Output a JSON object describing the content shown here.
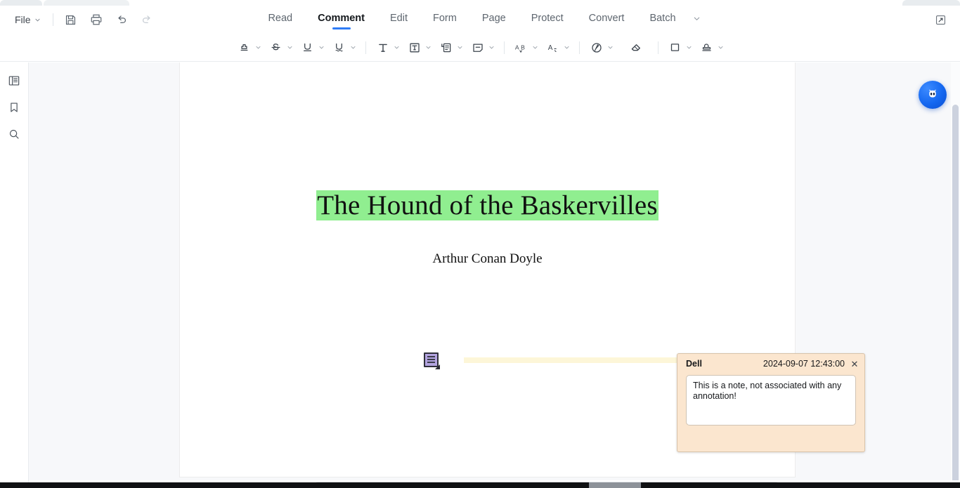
{
  "app": {
    "file_menu": "File",
    "quick_actions": [
      {
        "name": "save-button",
        "label": "Save",
        "enabled": true
      },
      {
        "name": "print-button",
        "label": "Print",
        "enabled": true
      },
      {
        "name": "undo-button",
        "label": "Undo",
        "enabled": true
      },
      {
        "name": "redo-button",
        "label": "Redo",
        "enabled": false
      }
    ],
    "expand_icon": "external-link-icon"
  },
  "ribbon": {
    "tabs": [
      {
        "label": "Read",
        "active": false
      },
      {
        "label": "Comment",
        "active": true
      },
      {
        "label": "Edit",
        "active": false
      },
      {
        "label": "Form",
        "active": false
      },
      {
        "label": "Page",
        "active": false
      },
      {
        "label": "Protect",
        "active": false
      },
      {
        "label": "Convert",
        "active": false
      },
      {
        "label": "Batch",
        "active": false
      }
    ],
    "more_icon": "chevron-down-icon",
    "active_underline_color": "#2f7cf6"
  },
  "toolbar": {
    "tools": [
      {
        "name": "highlight-tool",
        "icon": "highlighter-icon",
        "label": "Highlight",
        "caret": true
      },
      {
        "name": "strikethrough-tool",
        "icon": "strikethrough-icon",
        "label": "Strikethrough",
        "caret": true
      },
      {
        "name": "underline-tool",
        "icon": "underline-icon",
        "label": "Underline",
        "caret": true
      },
      {
        "name": "squiggly-underline-tool",
        "icon": "squiggly-underline-icon",
        "label": "Squiggly Underline",
        "caret": true
      },
      {
        "name": "separator-1",
        "icon": "separator",
        "label": "",
        "caret": false
      },
      {
        "name": "text-tool",
        "icon": "text-icon",
        "label": "Typewriter",
        "caret": true
      },
      {
        "name": "text-box-tool",
        "icon": "text-box-icon",
        "label": "Text Box",
        "caret": true
      },
      {
        "name": "callout-tool",
        "icon": "callout-icon",
        "label": "Callout",
        "caret": true
      },
      {
        "name": "note-tool",
        "icon": "sticky-note-icon",
        "label": "Note",
        "caret": true
      },
      {
        "name": "separator-2",
        "icon": "separator",
        "label": "",
        "caret": false
      },
      {
        "name": "insert-text-tool",
        "icon": "insert-text-ab-icon",
        "label": "Insert Text",
        "caret": true
      },
      {
        "name": "replace-text-tool",
        "icon": "replace-text-icon",
        "label": "Replace Text",
        "caret": true
      },
      {
        "name": "separator-3",
        "icon": "separator",
        "label": "",
        "caret": false
      },
      {
        "name": "pencil-tool",
        "icon": "ink-pen-icon",
        "label": "Pencil",
        "caret": true
      },
      {
        "name": "eraser-tool",
        "icon": "eraser-icon",
        "label": "Eraser",
        "caret": false
      },
      {
        "name": "separator-4",
        "icon": "separator",
        "label": "",
        "caret": false
      },
      {
        "name": "shape-tool",
        "icon": "rectangle-shape-icon",
        "label": "Shapes",
        "caret": true
      },
      {
        "name": "stamp-tool",
        "icon": "stamp-icon",
        "label": "Stamp",
        "caret": true
      }
    ]
  },
  "left_rail": {
    "items": [
      {
        "name": "sidebar-item-thumbnails",
        "icon": "page-thumbnails-icon",
        "label": "Thumbnails"
      },
      {
        "name": "sidebar-item-bookmarks",
        "icon": "bookmark-icon",
        "label": "Bookmarks"
      },
      {
        "name": "sidebar-item-search",
        "icon": "search-icon",
        "label": "Search"
      }
    ]
  },
  "document": {
    "title": "The Hound of the Baskervilles",
    "title_highlight_color": "#90ee90",
    "author": "Arthur Conan Doyle"
  },
  "note_annotation": {
    "marker_icon": "sticky-note-marker-icon",
    "marker_color": "#b3a4e0",
    "connector_color": "#fdf6d8",
    "popup": {
      "author": "Dell",
      "date": "2024-09-07 12:43:00",
      "close_icon": "close-icon",
      "text": "This is a note, not associated with any annotation!",
      "background_color": "#fbe6cf"
    }
  },
  "assistant": {
    "name": "ai-assistant-button",
    "icon": "ai-robot-icon",
    "color": "#1467f0"
  },
  "scrollbars": {
    "vertical_name": "vertical-scrollbar",
    "horizontal_name": "horizontal-scrollbar"
  }
}
